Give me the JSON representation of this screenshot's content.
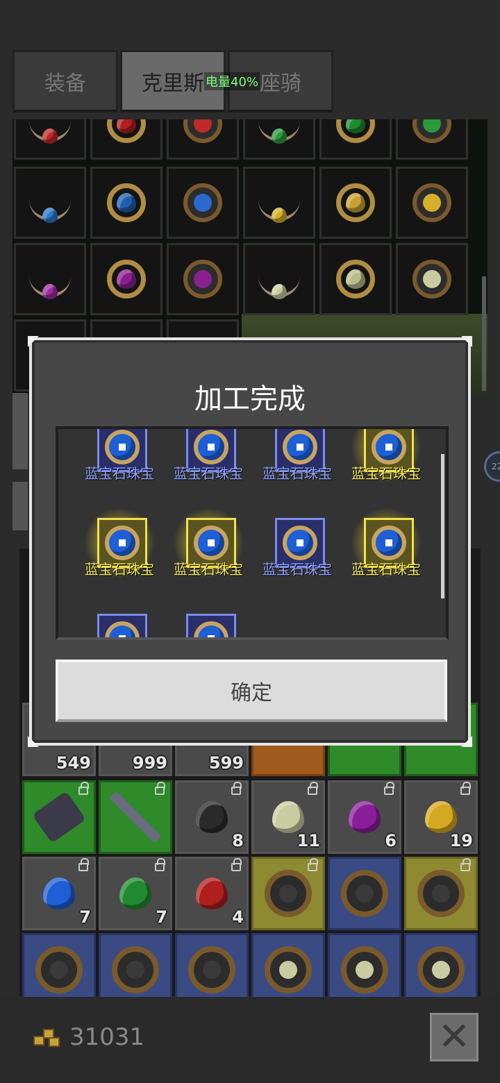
{
  "status_bar": {
    "battery": "电量40%"
  },
  "tabs": [
    {
      "label": "装备",
      "active": false
    },
    {
      "label": "克里斯",
      "active": true
    },
    {
      "label": "座骑",
      "active": false
    }
  ],
  "inventory": {
    "counts_row": [
      "549",
      "999",
      "599"
    ],
    "material_counts": [
      "8",
      "11",
      "6",
      "19",
      "7",
      "7",
      "4"
    ]
  },
  "side_badge": "22",
  "dialog": {
    "title": "加工完成",
    "item_name": "蓝宝石珠宝",
    "results": [
      {
        "name": "蓝宝石珠宝",
        "rarity": "blue"
      },
      {
        "name": "蓝宝石珠宝",
        "rarity": "blue"
      },
      {
        "name": "蓝宝石珠宝",
        "rarity": "blue"
      },
      {
        "name": "蓝宝石珠宝",
        "rarity": "gold"
      },
      {
        "name": "蓝宝石珠宝",
        "rarity": "gold"
      },
      {
        "name": "蓝宝石珠宝",
        "rarity": "gold"
      },
      {
        "name": "蓝宝石珠宝",
        "rarity": "blue"
      },
      {
        "name": "蓝宝石珠宝",
        "rarity": "gold"
      }
    ],
    "confirm_label": "确定"
  },
  "footer": {
    "gold_amount": "31031"
  },
  "colors": {
    "blue_rarity": "#8ea2ff",
    "gold_rarity": "#f4e75a",
    "battery": "#7cff7c"
  }
}
